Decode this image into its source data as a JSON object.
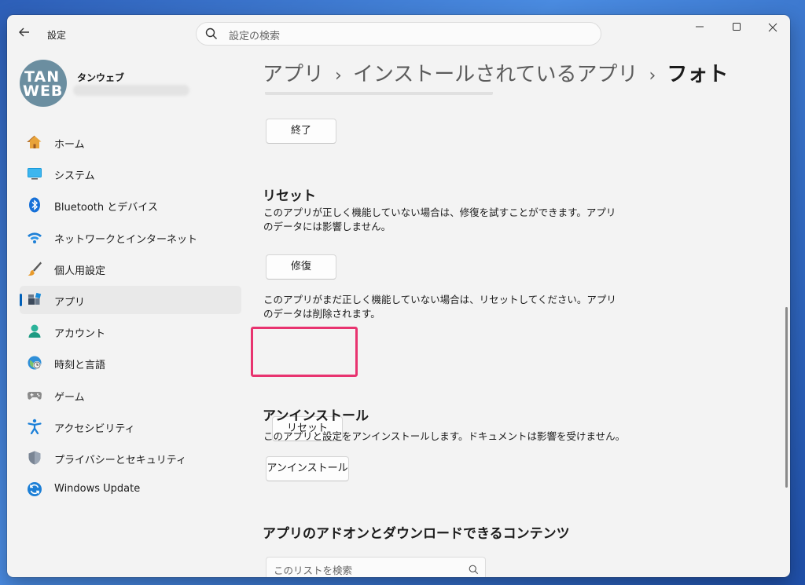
{
  "window": {
    "title": "設定",
    "search_placeholder": "設定の検索"
  },
  "profile": {
    "avatar_line1": "TAN",
    "avatar_line2": "WEB",
    "name": "タンウェブ"
  },
  "nav": [
    {
      "label": "ホーム",
      "icon": "home-icon"
    },
    {
      "label": "システム",
      "icon": "system-icon"
    },
    {
      "label": "Bluetooth とデバイス",
      "icon": "bluetooth-icon"
    },
    {
      "label": "ネットワークとインターネット",
      "icon": "wifi-icon"
    },
    {
      "label": "個人用設定",
      "icon": "brush-icon"
    },
    {
      "label": "アプリ",
      "icon": "apps-icon",
      "active": true
    },
    {
      "label": "アカウント",
      "icon": "account-icon"
    },
    {
      "label": "時刻と言語",
      "icon": "globe-clock-icon"
    },
    {
      "label": "ゲーム",
      "icon": "gamepad-icon"
    },
    {
      "label": "アクセシビリティ",
      "icon": "accessibility-icon"
    },
    {
      "label": "プライバシーとセキュリティ",
      "icon": "shield-icon"
    },
    {
      "label": "Windows Update",
      "icon": "update-icon"
    }
  ],
  "breadcrumb": {
    "level1": "アプリ",
    "level2": "インストールされているアプリ",
    "current": "フォト"
  },
  "terminate": {
    "button": "終了"
  },
  "reset": {
    "heading": "リセット",
    "repair_desc": "このアプリが正しく機能していない場合は、修復を試すことができます。アプリのデータには影響しません。",
    "repair_button": "修復",
    "reset_desc": "このアプリがまだ正しく機能していない場合は、リセットしてください。アプリのデータは削除されます。",
    "reset_button": "リセット"
  },
  "uninstall": {
    "heading": "アンインストール",
    "desc": "このアプリと設定をアンインストールします。ドキュメントは影響を受けません。",
    "button": "アンインストール"
  },
  "addons": {
    "heading": "アプリのアドオンとダウンロードできるコンテンツ",
    "search_placeholder": "このリストを検索"
  },
  "colors": {
    "accent": "#005fb8",
    "highlight": "#e8336f"
  }
}
